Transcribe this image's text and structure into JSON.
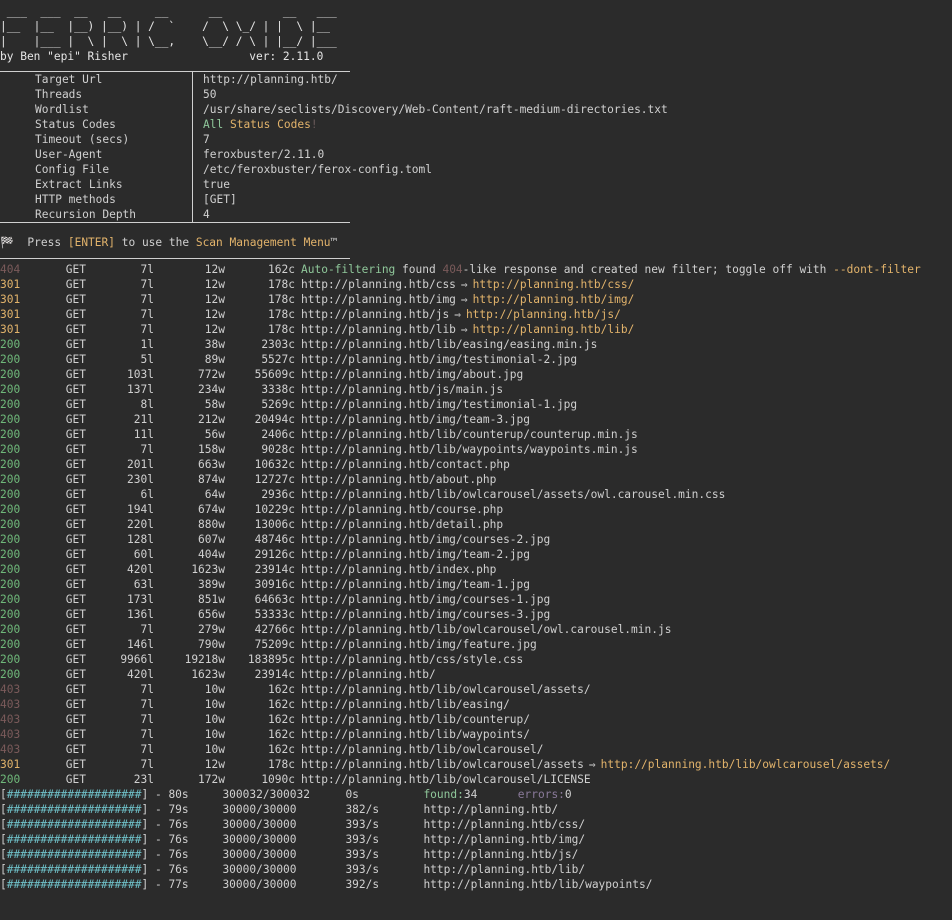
{
  "banner": {
    "ascii_line1": " ___  ___  __   __     __      __         __   ___",
    "ascii_line2": "|__  |__  |__) |__) | /  `    /  \\ \\_/ | |  \\ |__",
    "ascii_line3": "|    |___ |  \\ |  \\ | \\__,    \\__/ / \\ | |__/ |___",
    "author": "by Ben \"epi\" Risher",
    "version": "ver: 2.11.0"
  },
  "config": [
    {
      "key": "Target Url",
      "value": "http://planning.htb/"
    },
    {
      "key": "Threads",
      "value": "50"
    },
    {
      "key": "Wordlist",
      "value": "/usr/share/seclists/Discovery/Web-Content/raft-medium-directories.txt"
    },
    {
      "key": "Status Codes",
      "value": ""
    },
    {
      "key": "Timeout (secs)",
      "value": "7"
    },
    {
      "key": "User-Agent",
      "value": "feroxbuster/2.11.0"
    },
    {
      "key": "Config File",
      "value": "/etc/feroxbuster/ferox-config.toml"
    },
    {
      "key": "Extract Links",
      "value": "true"
    },
    {
      "key": "HTTP methods",
      "value": "[GET]"
    },
    {
      "key": "Recursion Depth",
      "value": "4"
    }
  ],
  "status_codes": {
    "all": "All",
    "status": "Status",
    "codes": "Codes",
    "bang": "!"
  },
  "press": {
    "icon": "🏁",
    "prefix": "Press ",
    "key": "[ENTER]",
    "mid": " to use the ",
    "menu": "Scan Management Menu",
    "tm": "™"
  },
  "filter_row": {
    "status": "404",
    "method": "GET",
    "lines": "7l",
    "words": "12w",
    "chars": "162c",
    "autof": "Auto-filtering",
    "found": " found ",
    "code": "404",
    "rest": "-like response and created new filter; toggle off with ",
    "flag": "--dont-filter"
  },
  "results": [
    {
      "status": "301",
      "method": "GET",
      "lines": "7l",
      "words": "12w",
      "chars": "178c",
      "url": "http://planning.htb/css",
      "redirect": "http://planning.htb/css/"
    },
    {
      "status": "301",
      "method": "GET",
      "lines": "7l",
      "words": "12w",
      "chars": "178c",
      "url": "http://planning.htb/img",
      "redirect": "http://planning.htb/img/"
    },
    {
      "status": "301",
      "method": "GET",
      "lines": "7l",
      "words": "12w",
      "chars": "178c",
      "url": "http://planning.htb/js",
      "redirect": "http://planning.htb/js/"
    },
    {
      "status": "301",
      "method": "GET",
      "lines": "7l",
      "words": "12w",
      "chars": "178c",
      "url": "http://planning.htb/lib",
      "redirect": "http://planning.htb/lib/"
    },
    {
      "status": "200",
      "method": "GET",
      "lines": "1l",
      "words": "38w",
      "chars": "2303c",
      "url": "http://planning.htb/lib/easing/easing.min.js",
      "redirect": ""
    },
    {
      "status": "200",
      "method": "GET",
      "lines": "5l",
      "words": "89w",
      "chars": "5527c",
      "url": "http://planning.htb/img/testimonial-2.jpg",
      "redirect": ""
    },
    {
      "status": "200",
      "method": "GET",
      "lines": "103l",
      "words": "772w",
      "chars": "55609c",
      "url": "http://planning.htb/img/about.jpg",
      "redirect": ""
    },
    {
      "status": "200",
      "method": "GET",
      "lines": "137l",
      "words": "234w",
      "chars": "3338c",
      "url": "http://planning.htb/js/main.js",
      "redirect": ""
    },
    {
      "status": "200",
      "method": "GET",
      "lines": "8l",
      "words": "58w",
      "chars": "5269c",
      "url": "http://planning.htb/img/testimonial-1.jpg",
      "redirect": ""
    },
    {
      "status": "200",
      "method": "GET",
      "lines": "21l",
      "words": "212w",
      "chars": "20494c",
      "url": "http://planning.htb/img/team-3.jpg",
      "redirect": ""
    },
    {
      "status": "200",
      "method": "GET",
      "lines": "11l",
      "words": "56w",
      "chars": "2406c",
      "url": "http://planning.htb/lib/counterup/counterup.min.js",
      "redirect": ""
    },
    {
      "status": "200",
      "method": "GET",
      "lines": "7l",
      "words": "158w",
      "chars": "9028c",
      "url": "http://planning.htb/lib/waypoints/waypoints.min.js",
      "redirect": ""
    },
    {
      "status": "200",
      "method": "GET",
      "lines": "201l",
      "words": "663w",
      "chars": "10632c",
      "url": "http://planning.htb/contact.php",
      "redirect": ""
    },
    {
      "status": "200",
      "method": "GET",
      "lines": "230l",
      "words": "874w",
      "chars": "12727c",
      "url": "http://planning.htb/about.php",
      "redirect": ""
    },
    {
      "status": "200",
      "method": "GET",
      "lines": "6l",
      "words": "64w",
      "chars": "2936c",
      "url": "http://planning.htb/lib/owlcarousel/assets/owl.carousel.min.css",
      "redirect": ""
    },
    {
      "status": "200",
      "method": "GET",
      "lines": "194l",
      "words": "674w",
      "chars": "10229c",
      "url": "http://planning.htb/course.php",
      "redirect": ""
    },
    {
      "status": "200",
      "method": "GET",
      "lines": "220l",
      "words": "880w",
      "chars": "13006c",
      "url": "http://planning.htb/detail.php",
      "redirect": ""
    },
    {
      "status": "200",
      "method": "GET",
      "lines": "128l",
      "words": "607w",
      "chars": "48746c",
      "url": "http://planning.htb/img/courses-2.jpg",
      "redirect": ""
    },
    {
      "status": "200",
      "method": "GET",
      "lines": "60l",
      "words": "404w",
      "chars": "29126c",
      "url": "http://planning.htb/img/team-2.jpg",
      "redirect": ""
    },
    {
      "status": "200",
      "method": "GET",
      "lines": "420l",
      "words": "1623w",
      "chars": "23914c",
      "url": "http://planning.htb/index.php",
      "redirect": ""
    },
    {
      "status": "200",
      "method": "GET",
      "lines": "63l",
      "words": "389w",
      "chars": "30916c",
      "url": "http://planning.htb/img/team-1.jpg",
      "redirect": ""
    },
    {
      "status": "200",
      "method": "GET",
      "lines": "173l",
      "words": "851w",
      "chars": "64663c",
      "url": "http://planning.htb/img/courses-1.jpg",
      "redirect": ""
    },
    {
      "status": "200",
      "method": "GET",
      "lines": "136l",
      "words": "656w",
      "chars": "53333c",
      "url": "http://planning.htb/img/courses-3.jpg",
      "redirect": ""
    },
    {
      "status": "200",
      "method": "GET",
      "lines": "7l",
      "words": "279w",
      "chars": "42766c",
      "url": "http://planning.htb/lib/owlcarousel/owl.carousel.min.js",
      "redirect": ""
    },
    {
      "status": "200",
      "method": "GET",
      "lines": "146l",
      "words": "790w",
      "chars": "75209c",
      "url": "http://planning.htb/img/feature.jpg",
      "redirect": ""
    },
    {
      "status": "200",
      "method": "GET",
      "lines": "9966l",
      "words": "19218w",
      "chars": "183895c",
      "url": "http://planning.htb/css/style.css",
      "redirect": ""
    },
    {
      "status": "200",
      "method": "GET",
      "lines": "420l",
      "words": "1623w",
      "chars": "23914c",
      "url": "http://planning.htb/",
      "redirect": ""
    },
    {
      "status": "403",
      "method": "GET",
      "lines": "7l",
      "words": "10w",
      "chars": "162c",
      "url": "http://planning.htb/lib/owlcarousel/assets/",
      "redirect": ""
    },
    {
      "status": "403",
      "method": "GET",
      "lines": "7l",
      "words": "10w",
      "chars": "162c",
      "url": "http://planning.htb/lib/easing/",
      "redirect": ""
    },
    {
      "status": "403",
      "method": "GET",
      "lines": "7l",
      "words": "10w",
      "chars": "162c",
      "url": "http://planning.htb/lib/counterup/",
      "redirect": ""
    },
    {
      "status": "403",
      "method": "GET",
      "lines": "7l",
      "words": "10w",
      "chars": "162c",
      "url": "http://planning.htb/lib/waypoints/",
      "redirect": ""
    },
    {
      "status": "403",
      "method": "GET",
      "lines": "7l",
      "words": "10w",
      "chars": "162c",
      "url": "http://planning.htb/lib/owlcarousel/",
      "redirect": ""
    },
    {
      "status": "301",
      "method": "GET",
      "lines": "7l",
      "words": "12w",
      "chars": "178c",
      "url": "http://planning.htb/lib/owlcarousel/assets",
      "redirect": "http://planning.htb/lib/owlcarousel/assets/"
    },
    {
      "status": "200",
      "method": "GET",
      "lines": "23l",
      "words": "172w",
      "chars": "1090c",
      "url": "http://planning.htb/lib/owlcarousel/LICENSE",
      "redirect": ""
    }
  ],
  "arrow": "⇒",
  "progress": [
    {
      "bar": "####################",
      "time": "80s",
      "count": "300032/300032",
      "rate": "0s",
      "url": "",
      "found_label": "found:",
      "found": "34",
      "errors_label": "errors:",
      "errors": "0"
    },
    {
      "bar": "####################",
      "time": "79s",
      "count": "30000/30000",
      "rate": "382/s",
      "url": "http://planning.htb/"
    },
    {
      "bar": "####################",
      "time": "76s",
      "count": "30000/30000",
      "rate": "393/s",
      "url": "http://planning.htb/css/"
    },
    {
      "bar": "####################",
      "time": "76s",
      "count": "30000/30000",
      "rate": "393/s",
      "url": "http://planning.htb/img/"
    },
    {
      "bar": "####################",
      "time": "76s",
      "count": "30000/30000",
      "rate": "393/s",
      "url": "http://planning.htb/js/"
    },
    {
      "bar": "####################",
      "time": "76s",
      "count": "30000/30000",
      "rate": "393/s",
      "url": "http://planning.htb/lib/"
    },
    {
      "bar": "####################",
      "time": "77s",
      "count": "30000/30000",
      "rate": "392/s",
      "url": "http://planning.htb/lib/waypoints/"
    }
  ],
  "progress_percent": 100,
  "colors": {
    "background": "#2b2b2b",
    "text": "#d0d0d0",
    "ok": "#6fb87a",
    "redirect": "#e2b36b",
    "forbidden": "#7a5a5a",
    "bar": "#6fc0c8"
  }
}
